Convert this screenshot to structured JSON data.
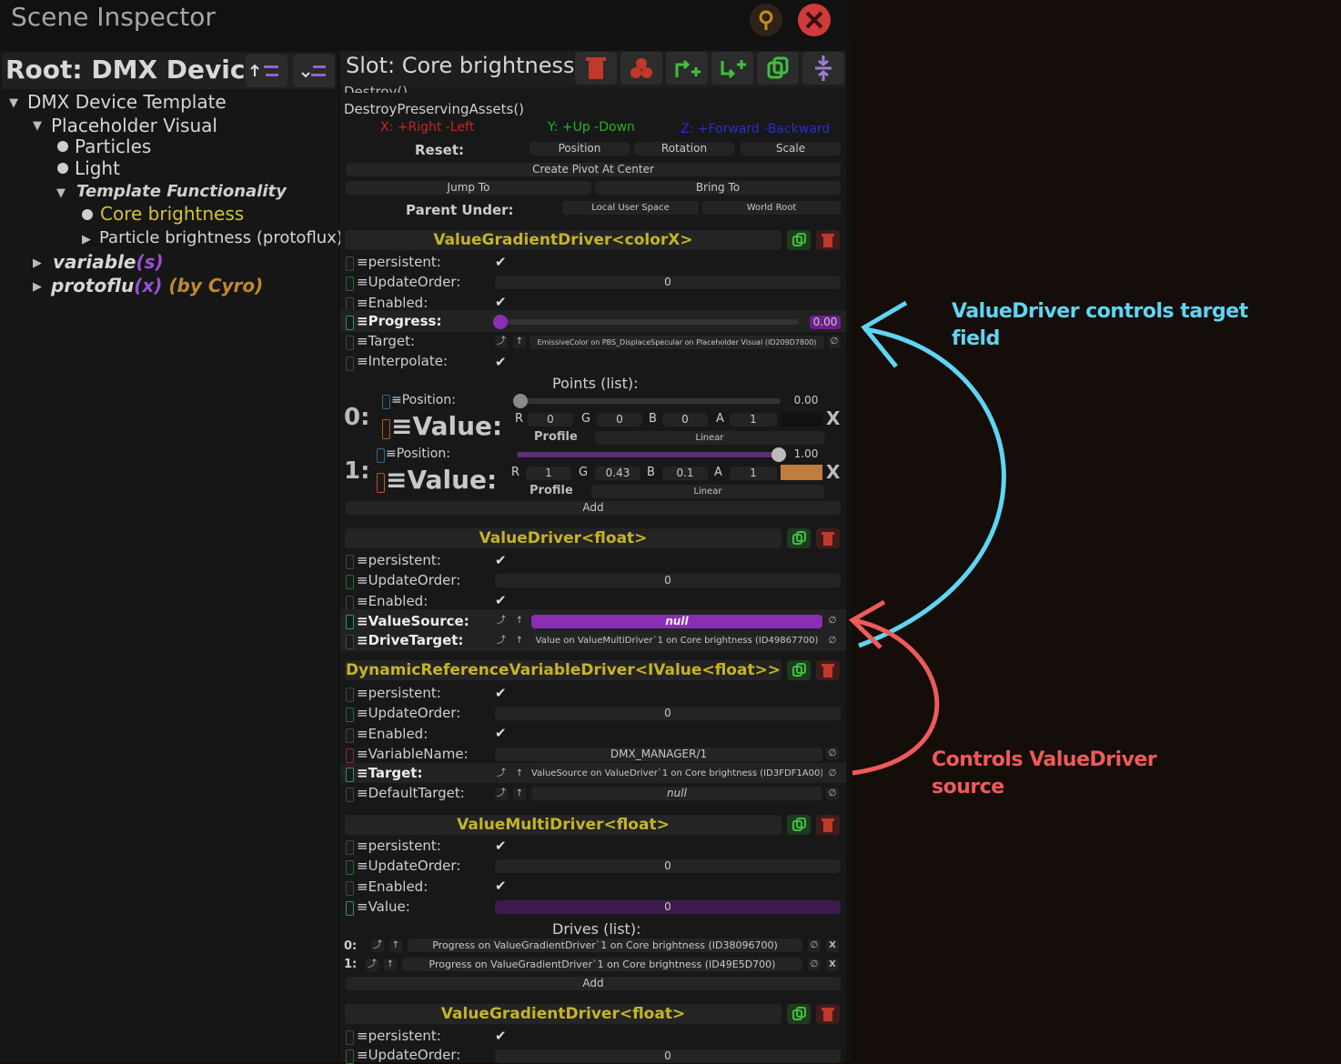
{
  "window": {
    "title": "Scene Inspector"
  },
  "left": {
    "root_title": "Root: DMX Device",
    "tree": [
      {
        "label": "DMX Device Template"
      },
      {
        "label": "Placeholder Visual"
      },
      {
        "label": "Particles"
      },
      {
        "label": "Light"
      },
      {
        "label": "Template Functionality"
      },
      {
        "label": "Core brightness"
      },
      {
        "label": "Particle brightness (protoflux)"
      }
    ],
    "variable": {
      "prefix": "variable",
      "paren_open": "(",
      "mid": "s",
      "paren_close": ")"
    },
    "protoflux": {
      "prefix": "protoflu",
      "paren_open": "(",
      "mid": "x",
      "paren_close": ")",
      "by": "(by Cyro)"
    }
  },
  "right": {
    "slot_title": "Slot: Core brightness",
    "destroy_partial": "Destroy()",
    "destroy_preserving": "DestroyPreservingAssets()",
    "axes": {
      "x": "X: +Right -Left",
      "y": "Y: +Up -Down",
      "z": "Z: +Forward -Backward"
    },
    "reset": {
      "label": "Reset:",
      "position": "Position",
      "rotation": "Rotation",
      "scale": "Scale"
    },
    "create_pivot": "Create Pivot At Center",
    "jump_to": "Jump To",
    "bring_to": "Bring To",
    "parent_under": {
      "label": "Parent Under:",
      "local": "Local User Space",
      "world": "World Root"
    }
  },
  "comp1": {
    "title": "ValueGradientDriver<colorX>",
    "persistent": "persistent:",
    "update_order": "UpdateOrder:",
    "update_order_value": "0",
    "enabled": "Enabled:",
    "progress": "Progress:",
    "progress_value": "0.00",
    "progress_fraction": 0.0,
    "target": "Target:",
    "target_value": "EmissiveColor on PBS_DisplaceSpecular on Placeholder Visual (ID209D7800)",
    "interpolate": "Interpolate:",
    "points_label": "Points (list):",
    "points": [
      {
        "index": "0:",
        "position_label": "Position:",
        "position_value": "0.00",
        "position_fraction": 0.0,
        "value_label": "Value:",
        "r": "0",
        "g": "0",
        "b": "0",
        "a": "1",
        "swatch": "#111111",
        "profile": "Profile",
        "interp": "Linear"
      },
      {
        "index": "1:",
        "position_label": "Position:",
        "position_value": "1.00",
        "position_fraction": 1.0,
        "value_label": "Value:",
        "r": "1",
        "g": "0.43",
        "b": "0.1",
        "a": "1",
        "swatch": "#c07d3c",
        "profile": "Profile",
        "interp": "Linear"
      }
    ],
    "add": "Add"
  },
  "comp2": {
    "title": "ValueDriver<float>",
    "persistent": "persistent:",
    "update_order": "UpdateOrder:",
    "update_order_value": "0",
    "enabled": "Enabled:",
    "value_source": "ValueSource:",
    "value_source_value": "null",
    "drive_target": "DriveTarget:",
    "drive_target_value": "Value on ValueMultiDriver`1 on Core brightness (ID49867700)"
  },
  "comp3": {
    "title": "DynamicReferenceVariableDriver<IValue<float>>",
    "persistent": "persistent:",
    "update_order": "UpdateOrder:",
    "update_order_value": "0",
    "enabled": "Enabled:",
    "variable_name": "VariableName:",
    "variable_name_value": "DMX_MANAGER/1",
    "target": "Target:",
    "target_value": "ValueSource on ValueDriver`1 on Core brightness (ID3FDF1A00)",
    "default_target": "DefaultTarget:",
    "default_target_value": "null"
  },
  "comp4": {
    "title": "ValueMultiDriver<float>",
    "persistent": "persistent:",
    "update_order": "UpdateOrder:",
    "update_order_value": "0",
    "enabled": "Enabled:",
    "value": "Value:",
    "value_value": "0",
    "drives_label": "Drives (list):",
    "drives": [
      {
        "index": "0:",
        "value": "Progress on ValueGradientDriver`1 on Core brightness (ID38096700)",
        "x": "X"
      },
      {
        "index": "1:",
        "value": "Progress on ValueGradientDriver`1 on Core brightness (ID49E5D700)",
        "x": "X"
      }
    ],
    "add": "Add"
  },
  "comp5": {
    "title": "ValueGradientDriver<float>",
    "persistent": "persistent:",
    "update_order": "UpdateOrder:",
    "update_order_value": "0"
  },
  "annotations": {
    "blue_line1": "ValueDriver controls target",
    "blue_line2": "field",
    "red_line1": "Controls ValueDriver",
    "red_line2": "source",
    "blue_color": "#5fd5f5",
    "red_color": "#ef5a5a"
  },
  "icons": {
    "close": "close-icon",
    "pin": "pin-icon",
    "delete": "trash-icon",
    "duplicate": "duplicate-icon",
    "check": "check-icon",
    "null_ref": "null-ref-icon"
  }
}
